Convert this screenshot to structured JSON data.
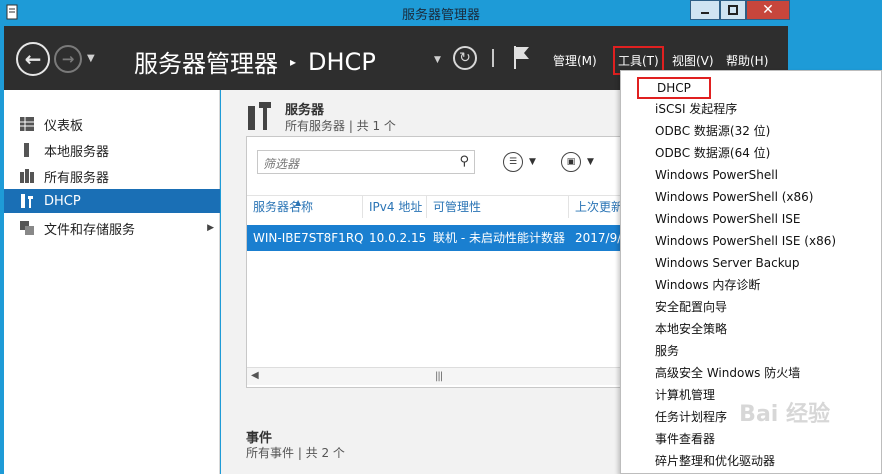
{
  "window": {
    "title": "服务器管理器",
    "close_glyph": "✕"
  },
  "header": {
    "breadcrumb_root": "服务器管理器",
    "breadcrumb_sep": "▸",
    "breadcrumb_current": "DHCP",
    "menus": {
      "manage": "管理(M)",
      "tools": "工具(T)",
      "view": "视图(V)",
      "help": "帮助(H)"
    }
  },
  "sidebar": {
    "items": [
      {
        "label": "仪表板",
        "icon": "dashboard-icon"
      },
      {
        "label": "本地服务器",
        "icon": "local-server-icon"
      },
      {
        "label": "所有服务器",
        "icon": "all-servers-icon"
      },
      {
        "label": "DHCP",
        "icon": "dhcp-icon",
        "active": true
      },
      {
        "label": "文件和存储服务",
        "icon": "file-storage-icon",
        "has_submenu": true
      }
    ]
  },
  "main": {
    "servers": {
      "title": "服务器",
      "subtitle": "所有服务器 | 共 1 个",
      "filter_placeholder": "筛选器",
      "columns": [
        "服务器名称",
        "IPv4 地址",
        "可管理性",
        "上次更新"
      ],
      "rows": [
        [
          "WIN-IBE7ST8F1RQ",
          "10.0.2.15",
          "联机 - 未启动性能计数器",
          "2017/9/"
        ]
      ]
    },
    "events": {
      "title": "事件",
      "subtitle": "所有事件 | 共 2 个"
    }
  },
  "tools_menu": {
    "items": [
      "DHCP",
      "iSCSI 发起程序",
      "ODBC 数据源(32 位)",
      "ODBC 数据源(64 位)",
      "Windows PowerShell",
      "Windows PowerShell (x86)",
      "Windows PowerShell ISE",
      "Windows PowerShell ISE (x86)",
      "Windows Server Backup",
      "Windows 内存诊断",
      "安全配置向导",
      "本地安全策略",
      "服务",
      "高级安全 Windows 防火墙",
      "计算机管理",
      "任务计划程序",
      "事件查看器",
      "碎片整理和优化驱动器"
    ],
    "highlighted_index": 0
  },
  "watermark": "Bai 经验",
  "colors": {
    "accent": "#1a7fd0",
    "header": "#2e2e2e",
    "frame": "#1e9bd7",
    "highlight_border": "#e02020"
  }
}
